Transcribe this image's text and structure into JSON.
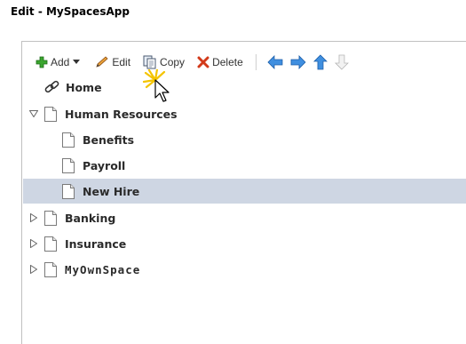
{
  "window": {
    "title": "Edit - MySpacesApp"
  },
  "toolbar": {
    "add_label": "Add",
    "edit_label": "Edit",
    "copy_label": "Copy",
    "delete_label": "Delete"
  },
  "tree": {
    "home": "Home",
    "human_resources": "Human Resources",
    "benefits": "Benefits",
    "payroll": "Payroll",
    "new_hire": "New Hire",
    "banking": "Banking",
    "insurance": "Insurance",
    "my_own_space": "MyOwnSpace"
  },
  "colors": {
    "selected_row": "#ced6e3",
    "add_icon": "#3aa52e",
    "delete_icon": "#d23a1a",
    "nav_arrow": "#3f8fe0"
  },
  "icons": [
    "plus-icon",
    "pencil-icon",
    "copy-icon",
    "delete-x-icon",
    "arrow-left-icon",
    "arrow-right-icon",
    "arrow-up-icon",
    "arrow-down-icon",
    "link-icon",
    "document-icon",
    "expand-triangle-icon",
    "collapse-triangle-icon",
    "mouse-cursor-icon"
  ]
}
